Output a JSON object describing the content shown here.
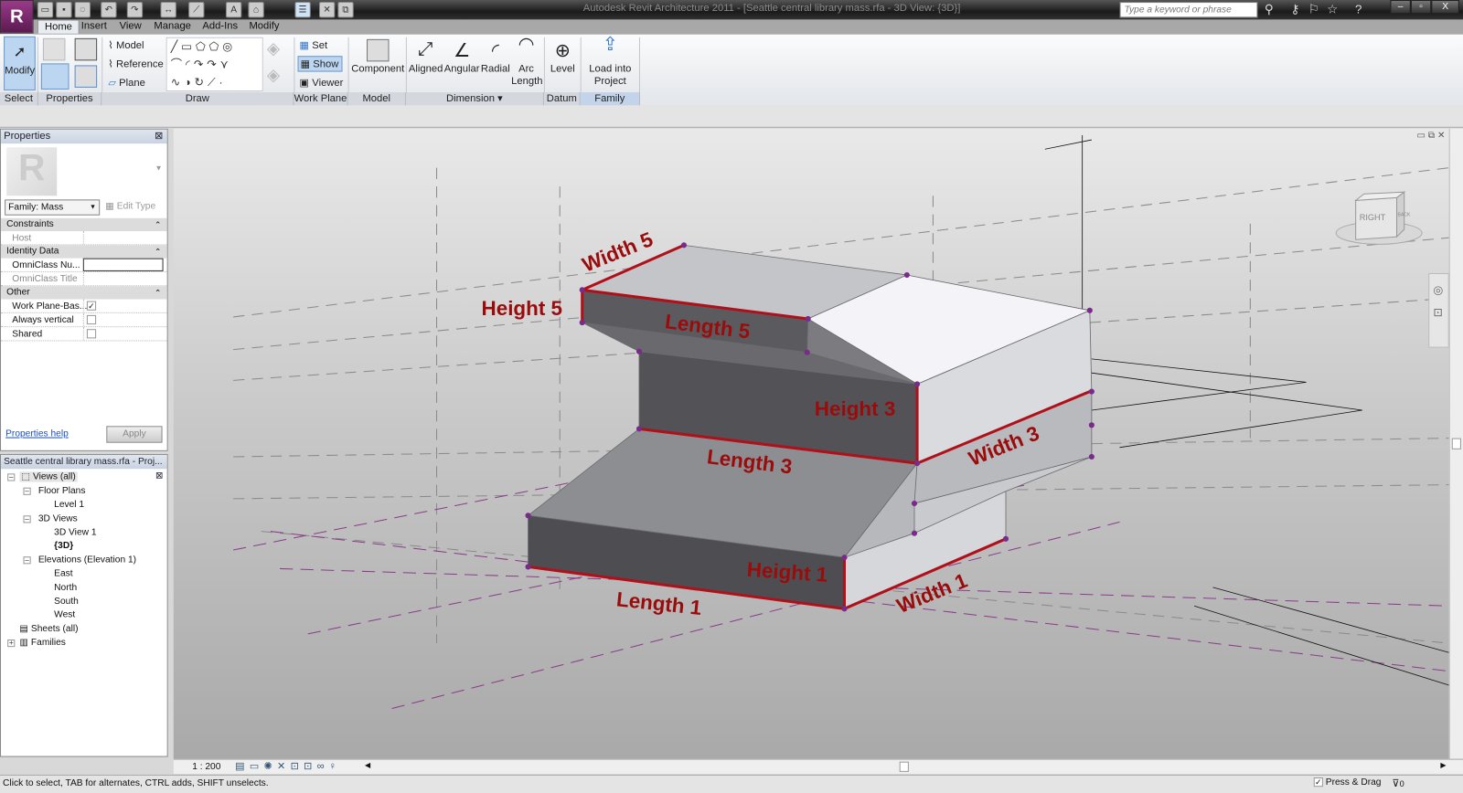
{
  "app": {
    "title": "Autodesk Revit Architecture 2011 - [Seattle central library mass.rfa - 3D View: {3D}]",
    "logo": "R"
  },
  "search": {
    "placeholder": "Type a keyword or phrase"
  },
  "tabs": [
    "Home",
    "Insert",
    "View",
    "Manage",
    "Add-Ins",
    "Modify"
  ],
  "ribbon": {
    "modify": "Modify",
    "draw": {
      "model": "Model",
      "reference": "Reference",
      "plane": "Plane"
    },
    "work_plane": {
      "set": "Set",
      "show": "Show",
      "viewer": "Viewer"
    },
    "component": "Component",
    "dimension": [
      "Aligned",
      "Angular",
      "Radial",
      "Arc Length"
    ],
    "level": "Level",
    "load": "Load into Project",
    "panels": [
      "Select",
      "Properties",
      "Draw",
      "Work Plane",
      "Model",
      "Dimension ▾",
      "Datum",
      "Family Editor"
    ]
  },
  "properties": {
    "title": "Properties",
    "type_selector": "Family: Mass",
    "edit_type": "Edit Type",
    "groups": {
      "constraints": "Constraints",
      "identity": "Identity Data",
      "other": "Other"
    },
    "rows": {
      "host": "Host",
      "omniclass_num": "OmniClass Nu...",
      "omniclass_title": "OmniClass Title",
      "work_plane": "Work Plane-Bas...",
      "always_vertical": "Always vertical",
      "shared": "Shared"
    },
    "checks": {
      "work_plane": true,
      "always_vertical": false,
      "shared": false
    },
    "help": "Properties help",
    "apply": "Apply"
  },
  "browser": {
    "title": "Seattle central library mass.rfa - Proj...",
    "views_all": "Views (all)",
    "floor_plans": "Floor Plans",
    "level1": "Level 1",
    "views3d": "3D Views",
    "view1": "3D View 1",
    "view3d": "{3D}",
    "elevations": "Elevations (Elevation 1)",
    "east": "East",
    "north": "North",
    "south": "South",
    "west": "West",
    "sheets": "Sheets (all)",
    "families": "Families"
  },
  "model_labels": {
    "width5": "Width 5",
    "height5": "Height 5",
    "length5": "Length 5",
    "height3": "Height 3",
    "length3": "Length 3",
    "width3": "Width 3",
    "height1": "Height 1",
    "length1": "Length 1",
    "width1": "Width 1"
  },
  "viewcube": {
    "right": "RIGHT",
    "back": "BACK"
  },
  "view_bar": {
    "scale": "1 : 200"
  },
  "status": {
    "hint": "Click to select, TAB for alternates, CTRL adds, SHIFT unselects.",
    "press_drag": "Press & Drag",
    "filter_count": "0"
  }
}
